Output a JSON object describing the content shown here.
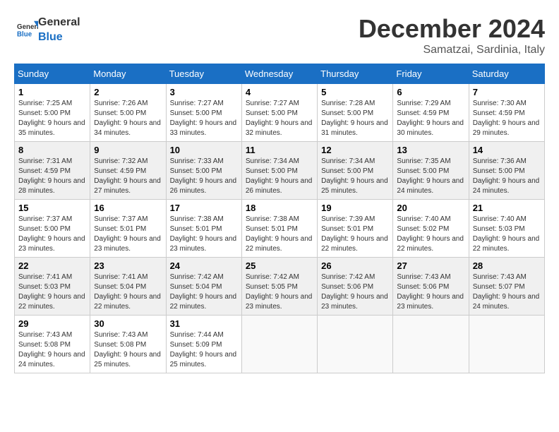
{
  "header": {
    "logo_general": "General",
    "logo_blue": "Blue",
    "month_title": "December 2024",
    "location": "Samatzai, Sardinia, Italy"
  },
  "calendar": {
    "days_of_week": [
      "Sunday",
      "Monday",
      "Tuesday",
      "Wednesday",
      "Thursday",
      "Friday",
      "Saturday"
    ],
    "weeks": [
      [
        null,
        null,
        null,
        null,
        null,
        null,
        null
      ]
    ],
    "cells": [
      {
        "day": "1",
        "sunrise": "7:25 AM",
        "sunset": "5:00 PM",
        "daylight": "9 hours and 35 minutes."
      },
      {
        "day": "2",
        "sunrise": "7:26 AM",
        "sunset": "5:00 PM",
        "daylight": "9 hours and 34 minutes."
      },
      {
        "day": "3",
        "sunrise": "7:27 AM",
        "sunset": "5:00 PM",
        "daylight": "9 hours and 33 minutes."
      },
      {
        "day": "4",
        "sunrise": "7:27 AM",
        "sunset": "5:00 PM",
        "daylight": "9 hours and 32 minutes."
      },
      {
        "day": "5",
        "sunrise": "7:28 AM",
        "sunset": "5:00 PM",
        "daylight": "9 hours and 31 minutes."
      },
      {
        "day": "6",
        "sunrise": "7:29 AM",
        "sunset": "4:59 PM",
        "daylight": "9 hours and 30 minutes."
      },
      {
        "day": "7",
        "sunrise": "7:30 AM",
        "sunset": "4:59 PM",
        "daylight": "9 hours and 29 minutes."
      },
      {
        "day": "8",
        "sunrise": "7:31 AM",
        "sunset": "4:59 PM",
        "daylight": "9 hours and 28 minutes."
      },
      {
        "day": "9",
        "sunrise": "7:32 AM",
        "sunset": "4:59 PM",
        "daylight": "9 hours and 27 minutes."
      },
      {
        "day": "10",
        "sunrise": "7:33 AM",
        "sunset": "5:00 PM",
        "daylight": "9 hours and 26 minutes."
      },
      {
        "day": "11",
        "sunrise": "7:34 AM",
        "sunset": "5:00 PM",
        "daylight": "9 hours and 26 minutes."
      },
      {
        "day": "12",
        "sunrise": "7:34 AM",
        "sunset": "5:00 PM",
        "daylight": "9 hours and 25 minutes."
      },
      {
        "day": "13",
        "sunrise": "7:35 AM",
        "sunset": "5:00 PM",
        "daylight": "9 hours and 24 minutes."
      },
      {
        "day": "14",
        "sunrise": "7:36 AM",
        "sunset": "5:00 PM",
        "daylight": "9 hours and 24 minutes."
      },
      {
        "day": "15",
        "sunrise": "7:37 AM",
        "sunset": "5:00 PM",
        "daylight": "9 hours and 23 minutes."
      },
      {
        "day": "16",
        "sunrise": "7:37 AM",
        "sunset": "5:01 PM",
        "daylight": "9 hours and 23 minutes."
      },
      {
        "day": "17",
        "sunrise": "7:38 AM",
        "sunset": "5:01 PM",
        "daylight": "9 hours and 23 minutes."
      },
      {
        "day": "18",
        "sunrise": "7:38 AM",
        "sunset": "5:01 PM",
        "daylight": "9 hours and 22 minutes."
      },
      {
        "day": "19",
        "sunrise": "7:39 AM",
        "sunset": "5:01 PM",
        "daylight": "9 hours and 22 minutes."
      },
      {
        "day": "20",
        "sunrise": "7:40 AM",
        "sunset": "5:02 PM",
        "daylight": "9 hours and 22 minutes."
      },
      {
        "day": "21",
        "sunrise": "7:40 AM",
        "sunset": "5:03 PM",
        "daylight": "9 hours and 22 minutes."
      },
      {
        "day": "22",
        "sunrise": "7:41 AM",
        "sunset": "5:03 PM",
        "daylight": "9 hours and 22 minutes."
      },
      {
        "day": "23",
        "sunrise": "7:41 AM",
        "sunset": "5:04 PM",
        "daylight": "9 hours and 22 minutes."
      },
      {
        "day": "24",
        "sunrise": "7:42 AM",
        "sunset": "5:04 PM",
        "daylight": "9 hours and 22 minutes."
      },
      {
        "day": "25",
        "sunrise": "7:42 AM",
        "sunset": "5:05 PM",
        "daylight": "9 hours and 23 minutes."
      },
      {
        "day": "26",
        "sunrise": "7:42 AM",
        "sunset": "5:06 PM",
        "daylight": "9 hours and 23 minutes."
      },
      {
        "day": "27",
        "sunrise": "7:43 AM",
        "sunset": "5:06 PM",
        "daylight": "9 hours and 23 minutes."
      },
      {
        "day": "28",
        "sunrise": "7:43 AM",
        "sunset": "5:07 PM",
        "daylight": "9 hours and 24 minutes."
      },
      {
        "day": "29",
        "sunrise": "7:43 AM",
        "sunset": "5:08 PM",
        "daylight": "9 hours and 24 minutes."
      },
      {
        "day": "30",
        "sunrise": "7:43 AM",
        "sunset": "5:08 PM",
        "daylight": "9 hours and 25 minutes."
      },
      {
        "day": "31",
        "sunrise": "7:44 AM",
        "sunset": "5:09 PM",
        "daylight": "9 hours and 25 minutes."
      }
    ],
    "start_day_of_week": 0
  }
}
